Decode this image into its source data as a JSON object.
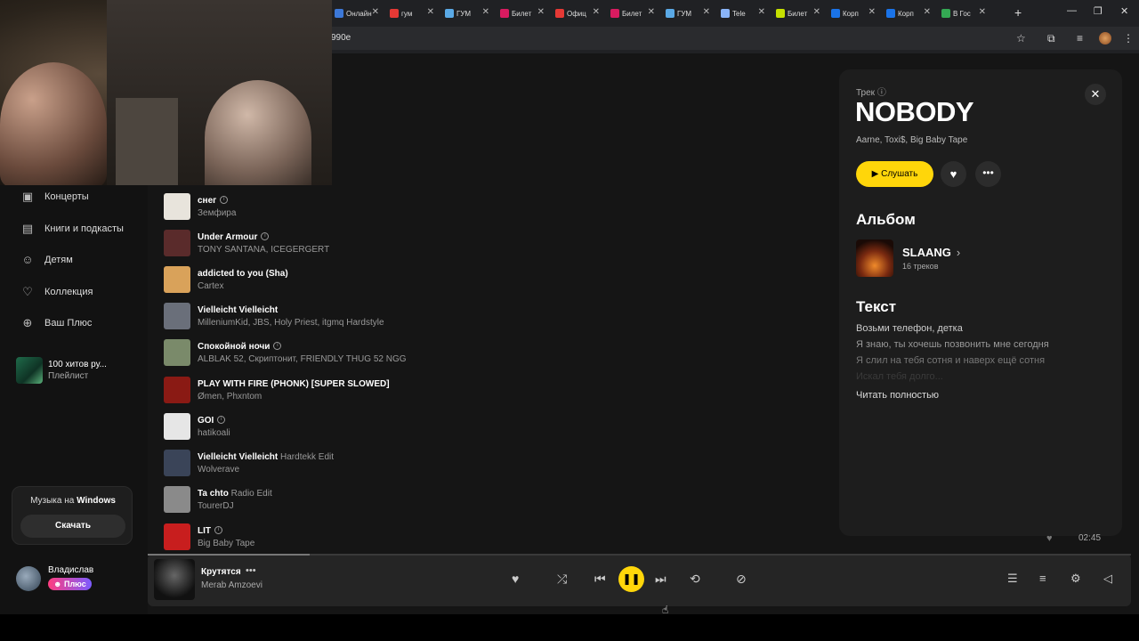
{
  "browser": {
    "tabs": [
      {
        "label": "Онлайн",
        "color": "#3c78d8"
      },
      {
        "label": "гум",
        "color": "#e53935"
      },
      {
        "label": "ГУМ",
        "color": "#5aa9e6"
      },
      {
        "label": "Билет",
        "color": "#d81b60"
      },
      {
        "label": "Офиц",
        "color": "#e53935"
      },
      {
        "label": "Билет",
        "color": "#d81b60"
      },
      {
        "label": "ГУМ",
        "color": "#5aa9e6"
      },
      {
        "label": "Tele",
        "color": "#8ab4f8"
      },
      {
        "label": "Билет",
        "color": "#c6e000"
      },
      {
        "label": "Корп",
        "color": "#1a73e8"
      },
      {
        "label": "Корп",
        "color": "#1a73e8"
      },
      {
        "label": "В Гос",
        "color": "#34a853"
      }
    ],
    "url": "990e"
  },
  "sidebar": {
    "nav": [
      {
        "label": "Концерты",
        "icon": "ticket-icon"
      },
      {
        "label": "Книги и подкасты",
        "icon": "book-icon"
      },
      {
        "label": "Детям",
        "icon": "kids-icon"
      },
      {
        "label": "Коллекция",
        "icon": "heart-icon"
      },
      {
        "label": "Ваш Плюс",
        "icon": "plus-icon"
      }
    ],
    "playlist": {
      "title": "100 хитов ру...",
      "subtitle": "Плейлист"
    },
    "promo": {
      "text": "Музыка на",
      "bold": "Windows",
      "button": "Скачать"
    },
    "user": {
      "name": "Владислав",
      "badge": "Плюс"
    }
  },
  "tracks": [
    {
      "title": "снег",
      "version": "",
      "info": true,
      "artists": "Земфира",
      "cover": "#e8e4dc"
    },
    {
      "title": "Under Armour",
      "version": "",
      "info": true,
      "artists": "TONY SANTANA, ICEGERGERT",
      "cover": "#5a2b2b"
    },
    {
      "title": "addicted to you (Sha)",
      "version": "",
      "info": false,
      "artists": "Cartex",
      "cover": "#d9a25a"
    },
    {
      "title": "Vielleicht Vielleicht",
      "version": "",
      "info": false,
      "artists": "MilleniumKid, JBS, Holy Priest, itgmq Hardstyle",
      "cover": "#6a6f7a"
    },
    {
      "title": "Спокойной ночи",
      "version": "",
      "info": true,
      "artists": "ALBLAK 52, Скриптонит, FRIENDLY THUG 52 NGG",
      "cover": "#7a8a6a"
    },
    {
      "title": "PLAY WITH FIRE (PHONK) [SUPER SLOWED]",
      "version": "",
      "info": false,
      "artists": "Ømen, Phxntom",
      "cover": "#8a1a14"
    },
    {
      "title": "GOI",
      "version": "",
      "info": true,
      "artists": "hatikoali",
      "cover": "#e6e6e6"
    },
    {
      "title": "Vielleicht Vielleicht",
      "version": "Hardtekk Edit",
      "info": false,
      "artists": "Wolverave",
      "cover": "#3a4458"
    },
    {
      "title": "Ta chto",
      "version": "Radio Edit",
      "info": false,
      "artists": "TourerDJ",
      "cover": "#8a8a8a"
    },
    {
      "title": "LIT",
      "version": "",
      "info": true,
      "artists": "Big Baby Tape",
      "cover": "#c81e1e"
    }
  ],
  "panel": {
    "label": "Трек",
    "title": "NOBODY",
    "artists": "Aarne, Toxi$, Big Baby Tape",
    "play": "Слушать",
    "album_heading": "Альбом",
    "album_name": "SLAANG",
    "album_tracks": "16 треков",
    "lyrics_heading": "Текст",
    "lyrics": [
      "Возьми телефон, детка",
      "Я знаю, ты хочешь позвонить мне сегодня",
      "Я слил на тебя сотня и наверх ещё сотня",
      "Искал тебя долго..."
    ],
    "read_all": "Читать полностью"
  },
  "list_footer": {
    "time": "02:45"
  },
  "player": {
    "title": "Крутятся",
    "artist": "Merab Amzoevi",
    "progress": 0.165
  }
}
